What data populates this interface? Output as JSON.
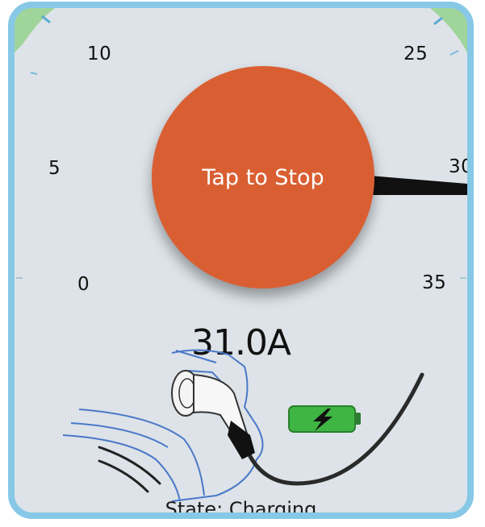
{
  "gauge": {
    "tick_labels": [
      "0",
      "5",
      "10",
      "25",
      "30",
      "35"
    ],
    "needle_value": 31.0,
    "accent_color": "#86c8e6",
    "green_zone_color": "#9fd49a"
  },
  "stop_button": {
    "label": "Tap to Stop",
    "color": "#d95f33"
  },
  "readout": {
    "current": "31.0A"
  },
  "status": {
    "state_text": "State: Charging"
  },
  "icons": {
    "plug": "ev-plug-icon",
    "battery": "battery-charging-icon",
    "bolt": "lightning-bolt-icon"
  }
}
